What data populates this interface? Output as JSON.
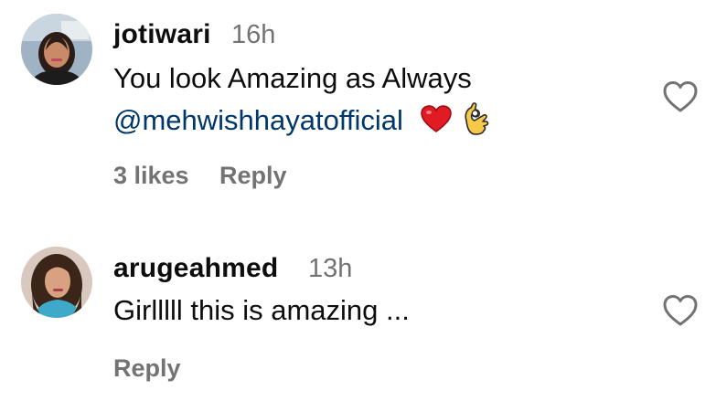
{
  "comments": [
    {
      "username": "jotiwari",
      "time": "16h",
      "line1": "You look Amazing as Always",
      "mention": "@mehwishhayatofficial",
      "emojis": [
        "red-heart",
        "ok-hand"
      ],
      "likes": "3 likes",
      "reply": "Reply"
    },
    {
      "username": "arugeahmed",
      "time": "13h",
      "line1": "Girlllll this is amazing ...",
      "reply": "Reply"
    }
  ],
  "colors": {
    "username": "#0d0d0d",
    "secondary": "#737373",
    "mention": "#00376b",
    "heart_outline": "#737373"
  },
  "icons": {
    "like": "heart-outline-icon"
  }
}
